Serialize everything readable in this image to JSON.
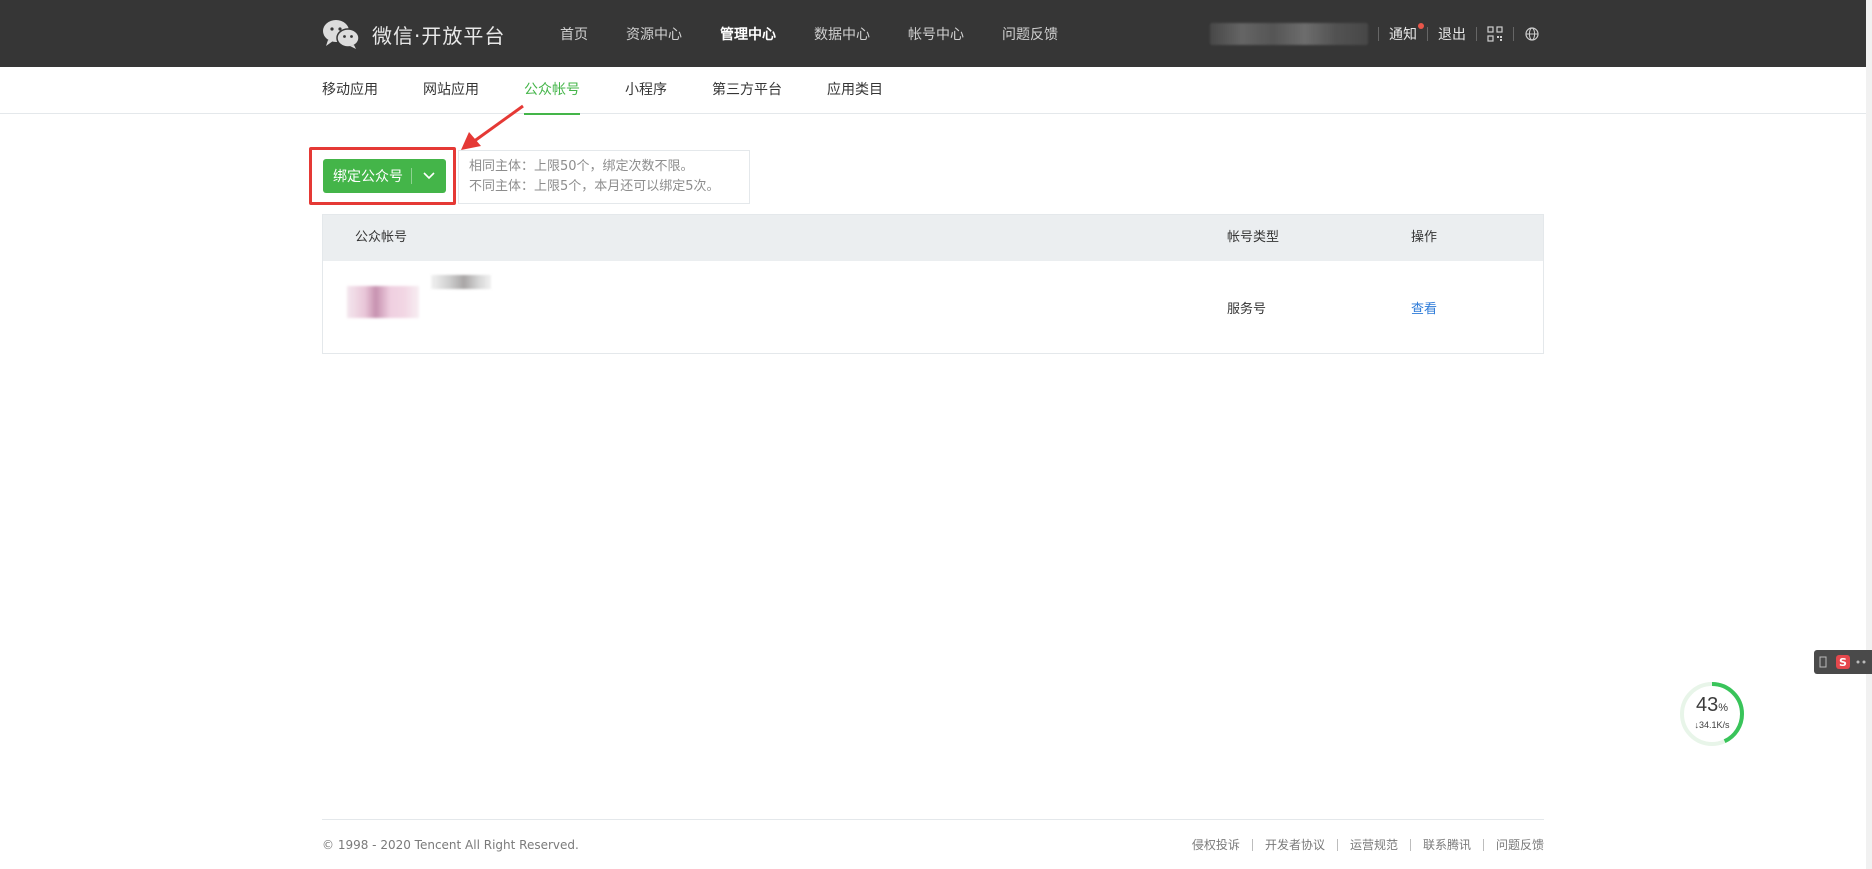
{
  "header": {
    "brand": "微信·开放平台",
    "nav": [
      {
        "label": "首页",
        "active": false
      },
      {
        "label": "资源中心",
        "active": false
      },
      {
        "label": "管理中心",
        "active": true
      },
      {
        "label": "数据中心",
        "active": false
      },
      {
        "label": "帐号中心",
        "active": false
      },
      {
        "label": "问题反馈",
        "active": false
      }
    ],
    "notice_label": "通知",
    "logout_label": "退出",
    "qr_icon": "qrcode-icon",
    "globe_icon": "globe-icon"
  },
  "subnav": {
    "tabs": [
      {
        "label": "移动应用",
        "active": false
      },
      {
        "label": "网站应用",
        "active": false
      },
      {
        "label": "公众帐号",
        "active": true
      },
      {
        "label": "小程序",
        "active": false
      },
      {
        "label": "第三方平台",
        "active": false
      },
      {
        "label": "应用类目",
        "active": false
      }
    ]
  },
  "bind": {
    "button_label": "绑定公众号",
    "tip_line1": "相同主体：上限50个，绑定次数不限。",
    "tip_line2": "不同主体：上限5个，本月还可以绑定5次。"
  },
  "table": {
    "headers": {
      "account": "公众帐号",
      "type": "帐号类型",
      "action": "操作"
    },
    "rows": [
      {
        "type": "服务号",
        "action": "查看"
      }
    ]
  },
  "footer": {
    "copyright": "© 1998 - 2020 Tencent All Right Reserved.",
    "links": [
      "侵权投诉",
      "开发者协议",
      "运营规范",
      "联系腾讯",
      "问题反馈"
    ]
  },
  "widget": {
    "percent": "43",
    "percent_sign": "%",
    "speed": "↓34.1K/s"
  },
  "colors": {
    "header_bg": "#363636",
    "accent_green": "#44b549",
    "highlight_red": "#e53935",
    "link_blue": "#2d7bd8"
  }
}
